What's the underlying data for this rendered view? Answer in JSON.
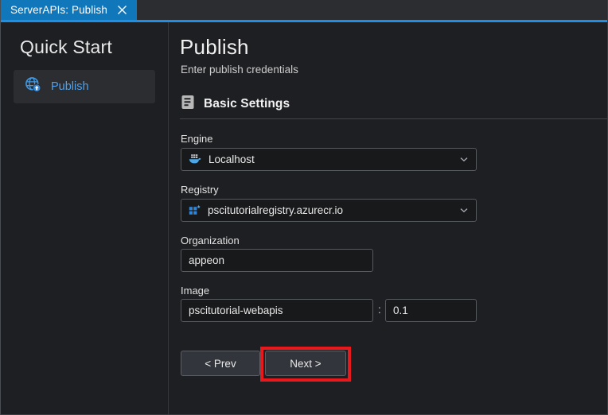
{
  "window": {
    "tab": {
      "label": "ServerAPIs: Publish",
      "close_icon": "close-icon"
    },
    "accent_color": "#1f8fe5"
  },
  "sidebar": {
    "title": "Quick Start",
    "items": [
      {
        "label": "Publish",
        "icon": "globe-upload-icon",
        "selected": true
      }
    ]
  },
  "main": {
    "title": "Publish",
    "subtitle": "Enter publish credentials",
    "section": {
      "title": "Basic Settings",
      "icon": "settings-list-icon"
    },
    "fields": {
      "engine": {
        "label": "Engine",
        "value": "Localhost",
        "icon": "docker-whale-icon",
        "type": "select"
      },
      "registry": {
        "label": "Registry",
        "value": "pscitutorialregistry.azurecr.io",
        "icon": "azure-container-registry-icon",
        "type": "select"
      },
      "organization": {
        "label": "Organization",
        "value": "appeon",
        "type": "text"
      },
      "image": {
        "label": "Image",
        "name_value": "pscitutorial-webapis",
        "separator": ":",
        "tag_value": "0.1",
        "type": "text"
      }
    },
    "buttons": {
      "prev": "< Prev",
      "next": "Next >"
    },
    "annotation": {
      "target": "next-button",
      "color": "#e8191c"
    }
  }
}
